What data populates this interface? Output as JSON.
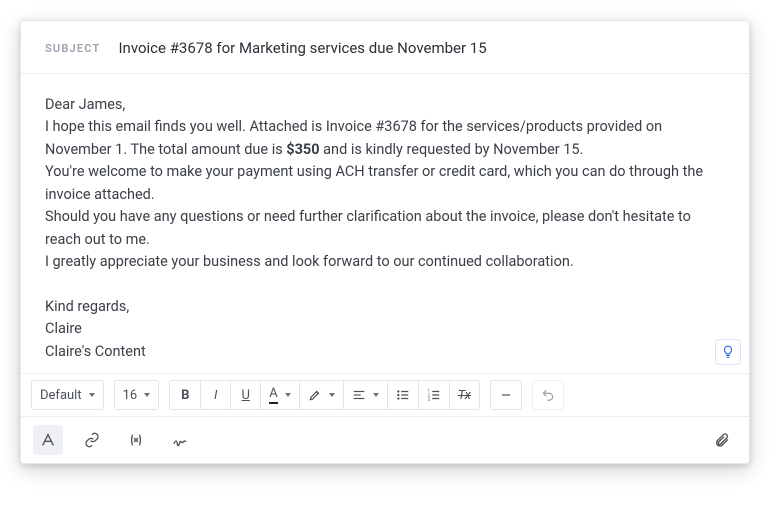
{
  "subject": {
    "label": "SUBJECT",
    "value": "Invoice #3678 for Marketing services due November 15"
  },
  "body": {
    "greeting": "Dear James,",
    "p1a": "I hope this email finds you well. Attached is Invoice #3678 for the services/products provided on November 1. The total amount due is ",
    "amount": "$350",
    "p1b": " and is kindly requested by November 15.",
    "p2": "You're welcome to make your payment using ACH transfer or credit card, which you can do through the invoice attached.",
    "p3": "Should you have any questions or need further clarification about the invoice, please don't hesitate to reach out to me.",
    "p4": "I greatly appreciate your business and look forward to our continued collaboration.",
    "closing1": "Kind regards,",
    "closing2": "Claire",
    "closing3": "Claire's Content"
  },
  "toolbar": {
    "font_family": "Default",
    "font_size": "16",
    "bold": "B",
    "italic": "I",
    "underline": "U",
    "text_color": "A",
    "clear_format": "Tx"
  }
}
